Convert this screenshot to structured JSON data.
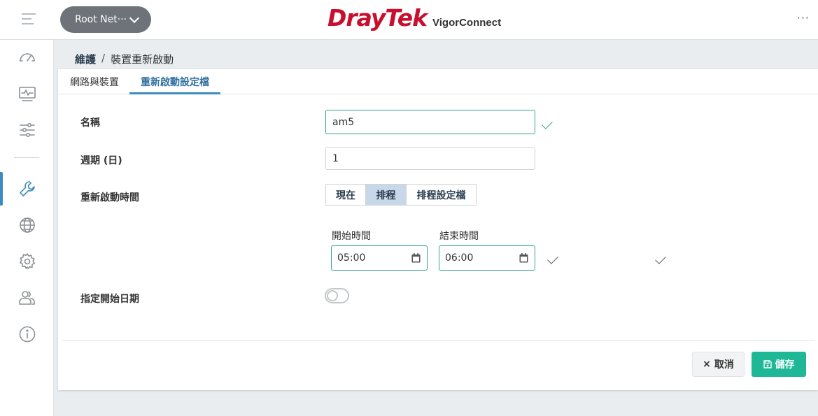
{
  "header": {
    "network_selector": "Root Net···",
    "brand_logo": "DrayTek",
    "brand_product": "VigorConnect",
    "more": "···"
  },
  "sidebar": {
    "items": [
      "dashboard-icon",
      "monitor-icon",
      "settings-sliders-icon",
      "wrench-icon",
      "globe-icon",
      "gear-icon",
      "users-icon",
      "info-icon"
    ],
    "active": "wrench-icon"
  },
  "breadcrumb": {
    "section": "維護",
    "separator": "/",
    "page": "裝置重新啟動"
  },
  "tabs": [
    {
      "label": "網路與裝置"
    },
    {
      "label": "重新啟動設定檔"
    }
  ],
  "form": {
    "name": {
      "label": "名稱",
      "value": "am5"
    },
    "period": {
      "label": "週期 (日)",
      "value": "1"
    },
    "reboot_time": {
      "label": "重新啟動時間",
      "options": [
        "現在",
        "排程",
        "排程設定檔"
      ],
      "selected": "排程"
    },
    "start_time": {
      "label": "開始時間",
      "value": "05:00"
    },
    "end_time": {
      "label": "結束時間",
      "value": "06:00"
    },
    "start_date": {
      "label": "指定開始日期",
      "enabled": false
    }
  },
  "actions": {
    "cancel": "取消",
    "cancel_glyph": "×",
    "save": "儲存"
  },
  "colors": {
    "brand_red": "#c8102e",
    "accent_blue": "#3d8cc0",
    "valid_green": "#2fa58d",
    "save_green": "#1fb896"
  }
}
